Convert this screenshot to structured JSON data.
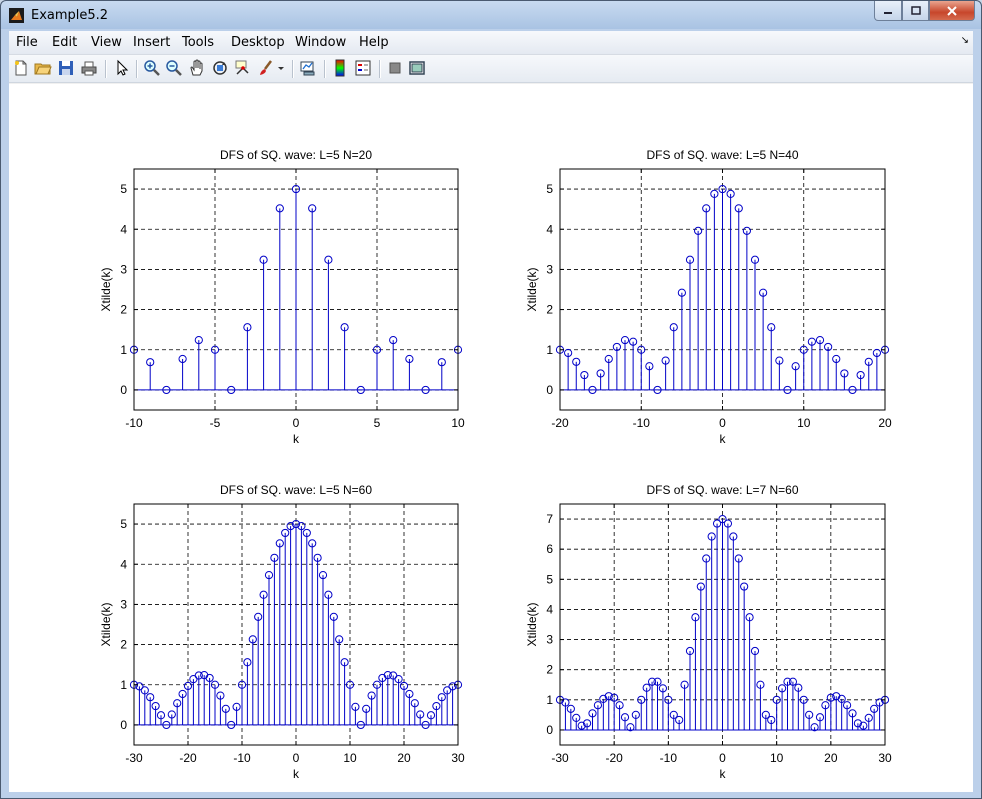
{
  "window": {
    "title": "Example5.2"
  },
  "menu": [
    "File",
    "Edit",
    "View",
    "Insert",
    "Tools",
    "Desktop",
    "Window",
    "Help"
  ],
  "toolbar": [
    "new-file-icon",
    "open-folder-icon",
    "save-icon",
    "print-icon",
    "select-arrow-icon",
    "zoom-in-icon",
    "zoom-out-icon",
    "pan-hand-icon",
    "rotate-3d-icon",
    "data-cursor-icon",
    "brush-icon",
    "brush-dropdown-icon",
    "link-plot-icon",
    "colorbar-icon",
    "legend-icon",
    "hide-plot-tools-icon",
    "show-plot-tools-icon"
  ],
  "colors": {
    "stem": "#0000c8",
    "axes": "#000000",
    "grid": "#000000",
    "figure_bg": "#ffffff"
  },
  "chart_data": [
    {
      "type": "stem",
      "title": "DFS of SQ. wave: L=5 N=20",
      "xlabel": "k",
      "ylabel": "Xtilde(k)",
      "xlim": [
        -10,
        10
      ],
      "ylim": [
        -0.5,
        5.5
      ],
      "xticks": [
        -10,
        -5,
        0,
        5,
        10
      ],
      "yticks": [
        0,
        1,
        2,
        3,
        4,
        5
      ],
      "grid": true,
      "x": [
        -10,
        -9,
        -8,
        -7,
        -6,
        -5,
        -4,
        -3,
        -2,
        -1,
        0,
        1,
        2,
        3,
        4,
        5,
        6,
        7,
        8,
        9,
        10
      ],
      "y": [
        1.0,
        0.69,
        0.0,
        0.77,
        1.24,
        1.0,
        0.0,
        1.56,
        3.24,
        4.52,
        5.0,
        4.52,
        3.24,
        1.56,
        0.0,
        1.0,
        1.24,
        0.77,
        0.0,
        0.69,
        1.0
      ]
    },
    {
      "type": "stem",
      "title": "DFS of SQ. wave: L=5 N=40",
      "xlabel": "k",
      "ylabel": "Xtilde(k)",
      "xlim": [
        -20,
        20
      ],
      "ylim": [
        -0.5,
        5.5
      ],
      "xticks": [
        -20,
        -10,
        0,
        10,
        20
      ],
      "yticks": [
        0,
        1,
        2,
        3,
        4,
        5
      ],
      "grid": true,
      "x": [
        -20,
        -19,
        -18,
        -17,
        -16,
        -15,
        -14,
        -13,
        -12,
        -11,
        -10,
        -9,
        -8,
        -7,
        -6,
        -5,
        -4,
        -3,
        -2,
        -1,
        0,
        1,
        2,
        3,
        4,
        5,
        6,
        7,
        8,
        9,
        10,
        11,
        12,
        13,
        14,
        15,
        16,
        17,
        18,
        19,
        20
      ],
      "y": [
        1.0,
        0.92,
        0.7,
        0.37,
        0.0,
        0.41,
        0.77,
        1.07,
        1.24,
        1.2,
        1.0,
        0.59,
        0.0,
        0.73,
        1.56,
        2.42,
        3.24,
        3.96,
        4.52,
        4.88,
        5.0,
        4.88,
        4.52,
        3.96,
        3.24,
        2.42,
        1.56,
        0.73,
        0.0,
        0.59,
        1.0,
        1.2,
        1.24,
        1.07,
        0.77,
        0.41,
        0.0,
        0.37,
        0.7,
        0.92,
        1.0
      ]
    },
    {
      "type": "stem",
      "title": "DFS of SQ. wave: L=5 N=60",
      "xlabel": "k",
      "ylabel": "Xtilde(k)",
      "xlim": [
        -30,
        30
      ],
      "ylim": [
        -0.5,
        5.5
      ],
      "xticks": [
        -30,
        -20,
        -10,
        0,
        10,
        20,
        30
      ],
      "yticks": [
        0,
        1,
        2,
        3,
        4,
        5
      ],
      "grid": true,
      "x": [
        -30,
        -29,
        -28,
        -27,
        -26,
        -25,
        -24,
        -23,
        -22,
        -21,
        -20,
        -19,
        -18,
        -17,
        -16,
        -15,
        -14,
        -13,
        -12,
        -11,
        -10,
        -9,
        -8,
        -7,
        -6,
        -5,
        -4,
        -3,
        -2,
        -1,
        0,
        1,
        2,
        3,
        4,
        5,
        6,
        7,
        8,
        9,
        10,
        11,
        12,
        13,
        14,
        15,
        16,
        17,
        18,
        19,
        20,
        21,
        22,
        23,
        24,
        25,
        26,
        27,
        28,
        29,
        30
      ],
      "y": [
        1.0,
        0.96,
        0.86,
        0.69,
        0.47,
        0.24,
        0.0,
        0.26,
        0.54,
        0.77,
        0.97,
        1.14,
        1.23,
        1.24,
        1.17,
        1.0,
        0.73,
        0.4,
        0.0,
        0.45,
        1.0,
        1.56,
        2.13,
        2.69,
        3.24,
        3.73,
        4.16,
        4.52,
        4.78,
        4.95,
        5.0,
        4.95,
        4.78,
        4.52,
        4.16,
        3.73,
        3.24,
        2.69,
        2.13,
        1.56,
        1.0,
        0.45,
        0.0,
        0.4,
        0.73,
        1.0,
        1.17,
        1.24,
        1.23,
        1.14,
        0.97,
        0.77,
        0.54,
        0.26,
        0.0,
        0.24,
        0.47,
        0.69,
        0.86,
        0.96,
        1.0
      ]
    },
    {
      "type": "stem",
      "title": "DFS of SQ. wave: L=7 N=60",
      "xlabel": "k",
      "ylabel": "Xtilde(k)",
      "xlim": [
        -30,
        30
      ],
      "ylim": [
        -0.5,
        7.5
      ],
      "xticks": [
        -30,
        -20,
        -10,
        0,
        10,
        20,
        30
      ],
      "yticks": [
        0,
        1,
        2,
        3,
        4,
        5,
        6,
        7
      ],
      "grid": true,
      "x": [
        -30,
        -29,
        -28,
        -27,
        -26,
        -25,
        -24,
        -23,
        -22,
        -21,
        -20,
        -19,
        -18,
        -17,
        -16,
        -15,
        -14,
        -13,
        -12,
        -11,
        -10,
        -9,
        -8,
        -7,
        -6,
        -5,
        -4,
        -3,
        -2,
        -1,
        0,
        1,
        2,
        3,
        4,
        5,
        6,
        7,
        8,
        9,
        10,
        11,
        12,
        13,
        14,
        15,
        16,
        17,
        18,
        19,
        20,
        21,
        22,
        23,
        24,
        25,
        26,
        27,
        28,
        29,
        30
      ],
      "y": [
        1.0,
        0.91,
        0.7,
        0.4,
        0.14,
        0.22,
        0.55,
        0.82,
        1.03,
        1.12,
        1.07,
        0.82,
        0.42,
        0.09,
        0.5,
        1.0,
        1.4,
        1.6,
        1.6,
        1.38,
        1.0,
        0.5,
        0.33,
        1.5,
        2.62,
        3.74,
        4.76,
        5.69,
        6.42,
        6.85,
        7.0,
        6.85,
        6.42,
        5.69,
        4.76,
        3.74,
        2.62,
        1.5,
        0.5,
        0.33,
        1.0,
        1.38,
        1.6,
        1.6,
        1.4,
        1.0,
        0.5,
        0.09,
        0.42,
        0.82,
        1.07,
        1.12,
        1.03,
        0.82,
        0.55,
        0.22,
        0.14,
        0.4,
        0.7,
        0.91,
        1.0
      ]
    }
  ]
}
